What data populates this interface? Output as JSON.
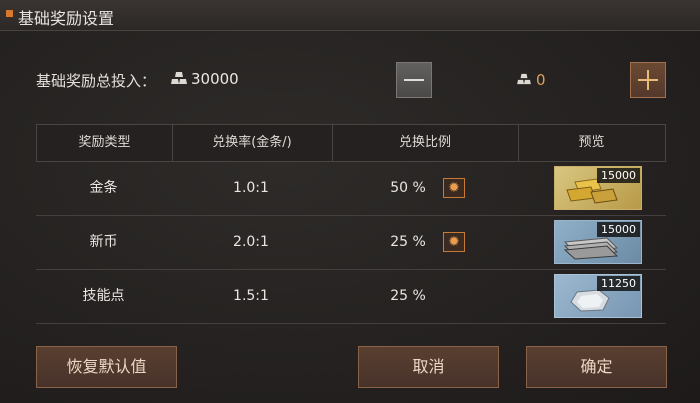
{
  "window": {
    "title": "基础奖励设置"
  },
  "total": {
    "label": "基础奖励总投入：",
    "value": "30000",
    "icon": "gold-bars-icon"
  },
  "adjust": {
    "value": "0",
    "icon": "gold-bars-icon"
  },
  "table": {
    "headers": [
      "奖励类型",
      "兑换率(金条/)",
      "兑换比例",
      "预览"
    ],
    "rows": [
      {
        "type": "金条",
        "rate": "1.0:1",
        "ratio": "50 %",
        "has_settings": true,
        "preview_count": "15000",
        "preview_icon": "gold-bars-icon"
      },
      {
        "type": "新币",
        "rate": "2.0:1",
        "ratio": "25 %",
        "has_settings": true,
        "preview_count": "15000",
        "preview_icon": "banknotes-icon"
      },
      {
        "type": "技能点",
        "rate": "1.5:1",
        "ratio": "25 %",
        "has_settings": false,
        "preview_count": "11250",
        "preview_icon": "skill-stone-icon"
      }
    ]
  },
  "buttons": {
    "restore": "恢复默认值",
    "cancel": "取消",
    "confirm": "确定"
  },
  "colors": {
    "accent": "#d9782a",
    "button_bg": "#54382a",
    "gold_preview": "#c9b06a",
    "silver_preview": "#8fb0c8"
  }
}
